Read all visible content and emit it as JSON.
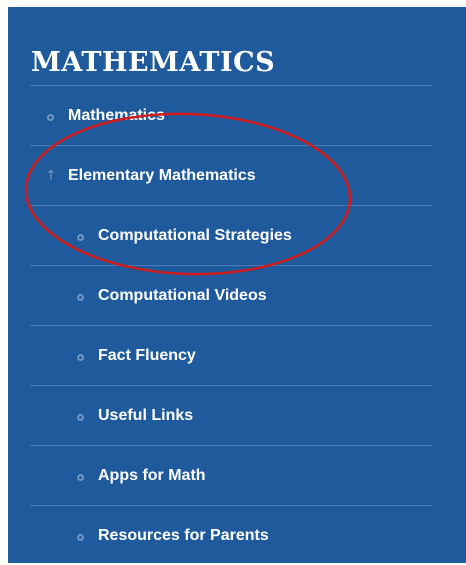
{
  "sidebar": {
    "heading": "MATHEMATICS",
    "items": [
      {
        "label": "Mathematics",
        "level": 1,
        "icon": "circle-bullet-icon"
      },
      {
        "label": "Elementary Mathematics",
        "level": 1,
        "icon": "arrow-up-icon"
      },
      {
        "label": "Computational Strategies",
        "level": 2,
        "icon": "circle-bullet-icon"
      },
      {
        "label": "Computational Videos",
        "level": 2,
        "icon": "circle-bullet-icon"
      },
      {
        "label": "Fact Fluency",
        "level": 2,
        "icon": "circle-bullet-icon"
      },
      {
        "label": "Useful Links",
        "level": 2,
        "icon": "circle-bullet-icon"
      },
      {
        "label": "Apps for Math",
        "level": 2,
        "icon": "circle-bullet-icon"
      },
      {
        "label": "Resources for Parents",
        "level": 2,
        "icon": "circle-bullet-icon"
      }
    ],
    "arrow_glyph": "↑"
  },
  "colors": {
    "panel_background": "#1f5a9c",
    "divider": "#4a7bb5",
    "bullet": "#6f97c6",
    "text": "#ffffff",
    "annotation": "#d01c1c"
  }
}
